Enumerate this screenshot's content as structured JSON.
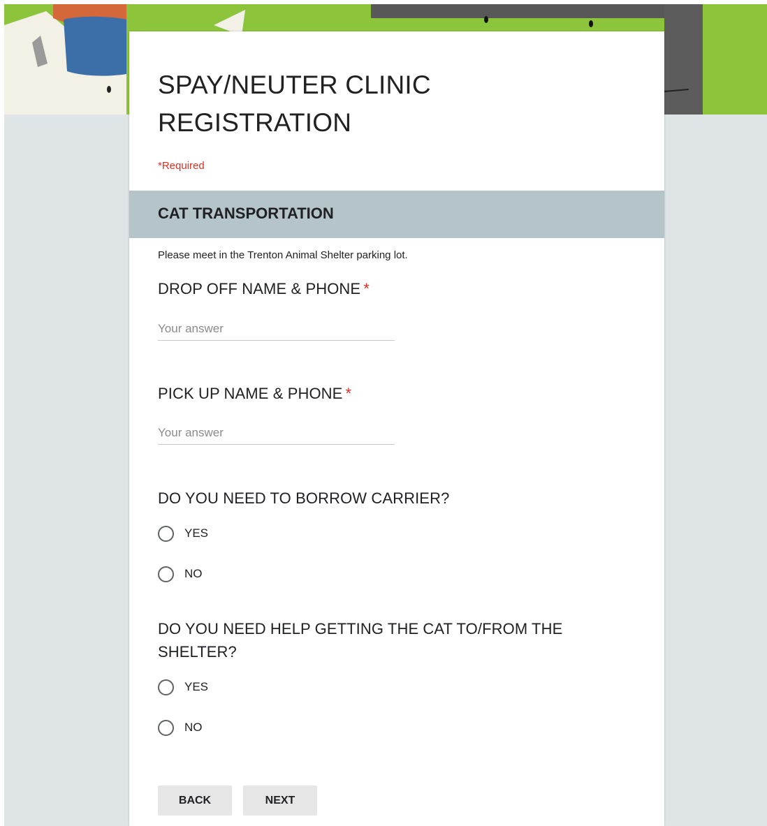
{
  "form": {
    "title": "SPAY/NEUTER CLINIC REGISTRATION",
    "required_note": "*Required"
  },
  "section": {
    "title": "CAT TRANSPORTATION",
    "description": "Please meet in the Trenton Animal Shelter parking lot."
  },
  "questions": [
    {
      "label": "DROP OFF NAME & PHONE",
      "required_mark": "*",
      "placeholder": "Your answer",
      "value": ""
    },
    {
      "label": "PICK UP NAME & PHONE",
      "required_mark": "*",
      "placeholder": "Your answer",
      "value": ""
    },
    {
      "label": "DO YOU NEED TO BORROW CARRIER?",
      "options": [
        "YES",
        "NO"
      ],
      "selected": null
    },
    {
      "label": "DO YOU NEED HELP GETTING THE CAT TO/FROM THE SHELTER?",
      "options": [
        "YES",
        "NO"
      ],
      "selected": null
    }
  ],
  "buttons": {
    "back": "BACK",
    "next": "NEXT"
  },
  "colors": {
    "banner_green": "#8cc43c",
    "section_header": "#b4c4c9",
    "page_background": "#dfe5e6",
    "required_red": "#d93025"
  },
  "icons": {
    "radio": "radio-unselected-icon"
  }
}
